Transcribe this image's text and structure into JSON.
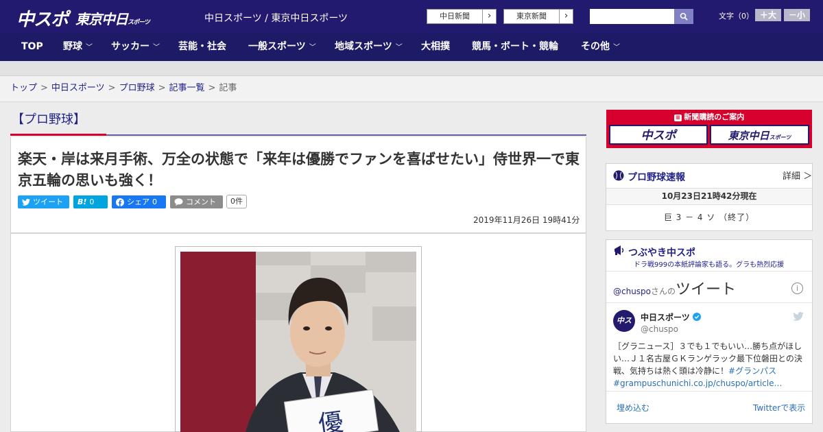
{
  "header": {
    "logo_chuspo": "中スポ",
    "logo_tokyo": "東京中日",
    "logo_tokyo_small": "スポーツ",
    "site_names": "中日スポーツ / 東京中日スポーツ",
    "paper_links": [
      "中日新聞",
      "東京新聞"
    ],
    "search_placeholder": "",
    "font_size_label": "文字（0）",
    "font_larger": "＋大",
    "font_smaller": "－小"
  },
  "nav": {
    "items": [
      {
        "label": "TOP",
        "dropdown": false
      },
      {
        "label": "野球",
        "dropdown": true
      },
      {
        "label": "サッカー",
        "dropdown": true
      },
      {
        "label": "芸能・社会",
        "dropdown": false
      },
      {
        "label": "一般スポーツ",
        "dropdown": true
      },
      {
        "label": "地域スポーツ",
        "dropdown": true
      },
      {
        "label": "大相撲",
        "dropdown": false
      },
      {
        "label": "競馬・ボート・競輪",
        "dropdown": false
      },
      {
        "label": "その他",
        "dropdown": true
      }
    ]
  },
  "breadcrumb": {
    "items": [
      "トップ",
      "中日スポーツ",
      "プロ野球",
      "記事一覧"
    ],
    "current": "記事"
  },
  "article": {
    "category": "【プロ野球】",
    "headline": "楽天・岸は来月手術、万全の状態で「来年は優勝でファンを喜ばせたい」侍世界一で東京五輪の思いも強く！",
    "share": {
      "tweet": "ツイート",
      "hatena_count": "0",
      "facebook": "シェア",
      "facebook_count": "0",
      "comment": "コメント",
      "comment_count": "0件"
    },
    "date": "2019年11月26日 19時41分",
    "photo_sign_text": "優"
  },
  "sidebar": {
    "ad_title": "新聞購読のご案内",
    "ad_logos": [
      "中スポ",
      "東京中日"
    ],
    "ad_logo_small": "スポーツ",
    "baseball": {
      "title": "プロ野球速報",
      "detail": "詳細 ＞",
      "as_of": "10月23日21時42分現在",
      "score": "巨 3 － 4 ソ （終了）"
    },
    "tweets": {
      "title": "つぶやき中スポ",
      "subtitle": "ドラ戦999の本紙評論家も語る。グラも熱烈応援",
      "handle_link": "@chuspo",
      "handle_suffix": "さんの",
      "tweets_word": "ツイート",
      "info": "i",
      "account_name": "中日スポーツ",
      "account_handle": "@chuspo",
      "text": "［グラニュース］３でも１でもいい…勝ち点がほしい…Ｊ１名古屋ＧＫランゲラック最下位磐田との決戦、気持ちは熱く頭は冷静に！",
      "tag1": "#グランパス",
      "tag2": "#grampuschunichi.co.jp/chuspo/article…",
      "embed": "埋め込む",
      "view_on_twitter": "Twitterで表示"
    }
  },
  "colors": {
    "header_bg": "#211a6e",
    "nav_bg": "#1d1a66",
    "link": "#22228a",
    "accent_red": "#d6002c",
    "twitter_blue": "#1da1f2",
    "hatena_blue": "#00a4de",
    "facebook_blue": "#1877f2"
  }
}
